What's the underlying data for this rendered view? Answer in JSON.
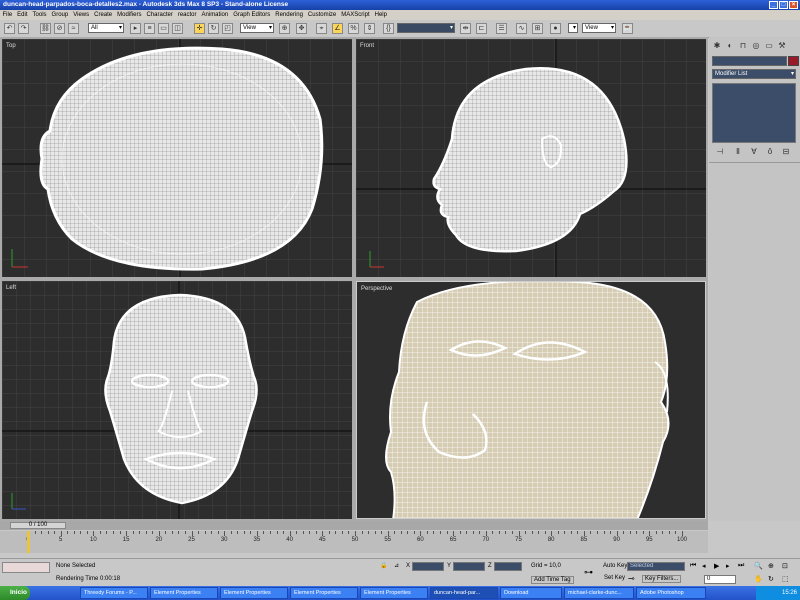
{
  "window": {
    "title": "duncan-head-parpados-boca-detalles2.max - Autodesk 3ds Max 8 SP3 - Stand-alone License"
  },
  "menu": [
    "File",
    "Edit",
    "Tools",
    "Group",
    "Views",
    "Create",
    "Modifiers",
    "Character",
    "reactor",
    "Animation",
    "Graph Editors",
    "Rendering",
    "Customize",
    "MAXScript",
    "Help"
  ],
  "toolbar": {
    "selection_filter": "All",
    "ref_coord": "View",
    "named_sel": "",
    "view2": "View"
  },
  "viewports": {
    "top": "Top",
    "front": "Front",
    "left": "Left",
    "perspective": "Perspective"
  },
  "command_panel": {
    "modifier_list": "Modifier List"
  },
  "timeline": {
    "slider_label": "0 / 100",
    "ticks": [
      "0",
      "5",
      "10",
      "15",
      "20",
      "25",
      "30",
      "35",
      "40",
      "45",
      "50",
      "55",
      "60",
      "65",
      "70",
      "75",
      "80",
      "85",
      "90",
      "95",
      "100"
    ]
  },
  "status": {
    "selection": "None Selected",
    "render_time": "Rendering Time  0:00:18",
    "x_label": "X",
    "x_value": "",
    "y_label": "Y",
    "y_value": "",
    "z_label": "Z",
    "z_value": "",
    "grid": "Grid = 10,0",
    "add_time_tag": "Add Time Tag",
    "auto_key": "Auto Key",
    "set_key": "Set Key",
    "selected_dd": "Selected",
    "key_filters": "Key Filters...",
    "frame": "0"
  },
  "taskbar": {
    "start": "Inicio",
    "tasks": [
      "Threedy Forums - P...",
      "Element Properties",
      "Element Properties",
      "Element Properties",
      "Element Properties",
      "duncan-head-par...",
      "Download",
      "michael-clarke-dunc...",
      "Adobe Photoshop"
    ],
    "clock": "15:26"
  }
}
